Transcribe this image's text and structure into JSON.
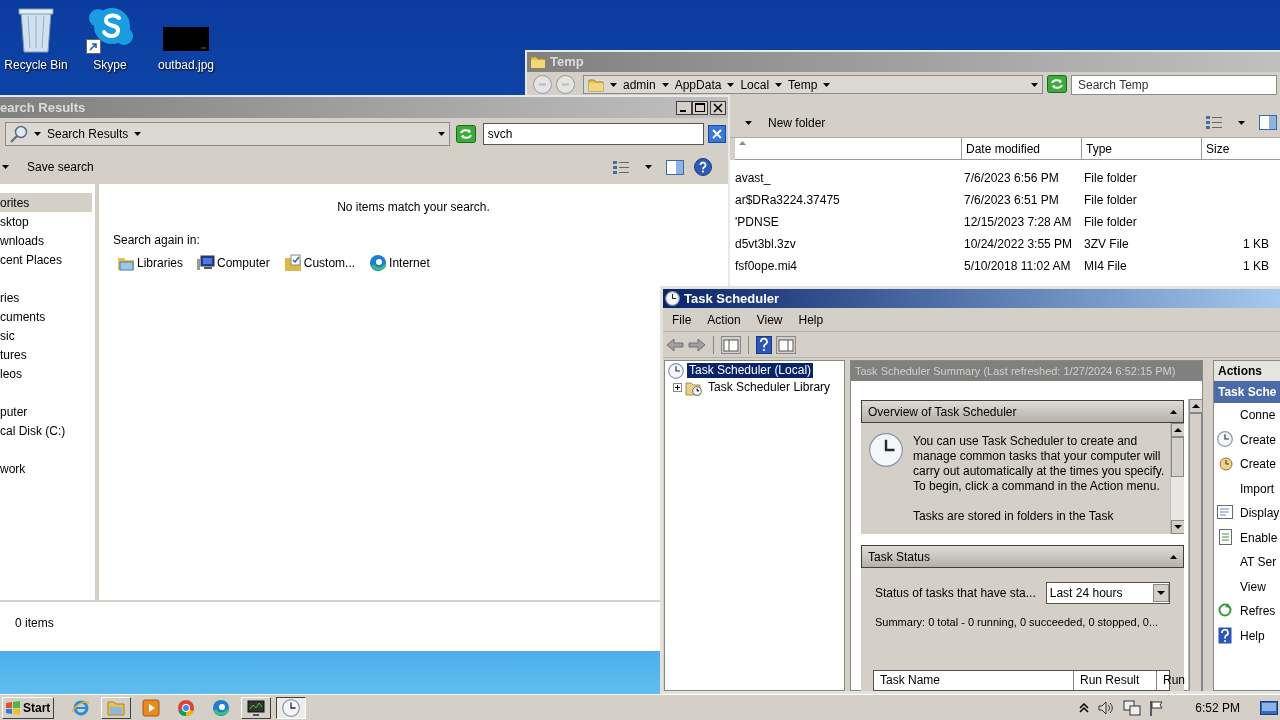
{
  "desktop_icons": [
    {
      "label": "Recycle Bin",
      "kind": "recycle"
    },
    {
      "label": "Skype",
      "kind": "skype"
    },
    {
      "label": "outbad.jpg",
      "kind": "image"
    }
  ],
  "temp_window": {
    "title": "Temp",
    "breadcrumb": [
      "admin",
      "AppData",
      "Local",
      "Temp"
    ],
    "search": {
      "placeholder": "Search Temp"
    },
    "toolbar": [
      "New folder"
    ],
    "columns": [
      "Date modified",
      "Type",
      "Size"
    ],
    "rows": [
      {
        "name": "avast_",
        "date": "7/6/2023 6:56 PM",
        "type": "File folder"
      },
      {
        "name": "ar$DRa3224.37475",
        "date": "7/6/2023 6:51 PM",
        "type": "File folder"
      },
      {
        "name": "'PDNSE",
        "date": "12/15/2023 7:28 AM",
        "type": "File folder"
      },
      {
        "name": "d5vt3bl.3zv",
        "date": "10/24/2022 3:55 PM",
        "type": "3ZV File",
        "size": "1 KB"
      },
      {
        "name": "fsf0ope.mi4",
        "date": "5/10/2018 11:02 AM",
        "type": "MI4 File",
        "size": "1 KB"
      }
    ]
  },
  "search_window": {
    "title": "earch Results",
    "location": "Search Results",
    "search": {
      "value": "svch"
    },
    "toolbar": [
      "Save search"
    ],
    "nav_groups": [
      {
        "items": [
          {
            "label": "orites",
            "selected": true
          },
          {
            "label": "sktop",
            "selected": false
          },
          {
            "label": "wnloads",
            "selected": false
          },
          {
            "label": "cent Places",
            "selected": false
          }
        ]
      },
      {
        "items": [
          {
            "label": "ries",
            "selected": false
          },
          {
            "label": "cuments",
            "selected": false
          },
          {
            "label": "sic",
            "selected": false
          },
          {
            "label": "tures",
            "selected": false
          },
          {
            "label": "leos",
            "selected": false
          }
        ]
      },
      {
        "items": [
          {
            "label": "puter",
            "selected": false
          },
          {
            "label": "cal Disk (C:)",
            "selected": false
          }
        ]
      },
      {
        "items": [
          {
            "label": "work",
            "selected": false
          }
        ]
      }
    ],
    "message": "No items match your search.",
    "search_again": {
      "label": "Search again in:",
      "options": [
        {
          "label": "Libraries",
          "kind": "libraries"
        },
        {
          "label": "Computer",
          "kind": "computer"
        },
        {
          "label": "Custom...",
          "kind": "custom"
        },
        {
          "label": "Internet",
          "kind": "internet"
        }
      ]
    },
    "status": "0 items"
  },
  "task_scheduler": {
    "title": "Task Scheduler",
    "menu": [
      "File",
      "Action",
      "View",
      "Help"
    ],
    "tree": [
      {
        "label": "Task Scheduler (Local)",
        "selected": true,
        "children": [
          {
            "label": "Task Scheduler Library",
            "selected": false,
            "expanded": false
          }
        ]
      }
    ],
    "summary_header": "Task Scheduler Summary (Last refreshed: 1/27/2024 6:52:15 PM)",
    "overview": {
      "title": "Overview of Task Scheduler",
      "expanded": true,
      "paragraphs": [
        "You can use Task Scheduler to create and manage common tasks that your computer will carry out automatically at the times you specify. To begin, click a command in the Action menu.",
        "Tasks are stored in folders in the Task"
      ]
    },
    "task_status": {
      "title": "Task Status",
      "expanded": true,
      "status_label": "Status of tasks that have sta...",
      "period": "Last 24 hours",
      "summary": "Summary: 0 total - 0 running, 0 succeeded, 0 stopped, 0...",
      "columns": [
        "Task Name",
        "Run Result",
        "Run"
      ]
    },
    "actions": {
      "title": "Actions",
      "group": "Task Sche",
      "items": [
        {
          "label": "Conne",
          "kind": "none"
        },
        {
          "label": "Create",
          "kind": "clock"
        },
        {
          "label": "Create",
          "kind": "basic"
        },
        {
          "label": "Import",
          "kind": "none"
        },
        {
          "label": "Display",
          "kind": "list"
        },
        {
          "label": "Enable",
          "kind": "enable"
        },
        {
          "label": "AT Ser",
          "kind": "none"
        },
        {
          "label": "View",
          "kind": "none"
        },
        {
          "label": "Refres",
          "kind": "refresh"
        },
        {
          "label": "Help",
          "kind": "help"
        }
      ]
    }
  },
  "taskbar": {
    "start": "Start",
    "apps": [
      {
        "kind": "ie",
        "running": false,
        "selected": false
      },
      {
        "kind": "explorer",
        "running": true,
        "selected": false
      },
      {
        "kind": "media",
        "running": false,
        "selected": false
      },
      {
        "kind": "chrome",
        "running": false,
        "selected": false
      },
      {
        "kind": "edge",
        "running": false,
        "selected": false
      },
      {
        "kind": "monitor",
        "running": true,
        "selected": false
      },
      {
        "kind": "scheduler",
        "running": true,
        "selected": true
      }
    ],
    "clock": "6:52 PM"
  }
}
